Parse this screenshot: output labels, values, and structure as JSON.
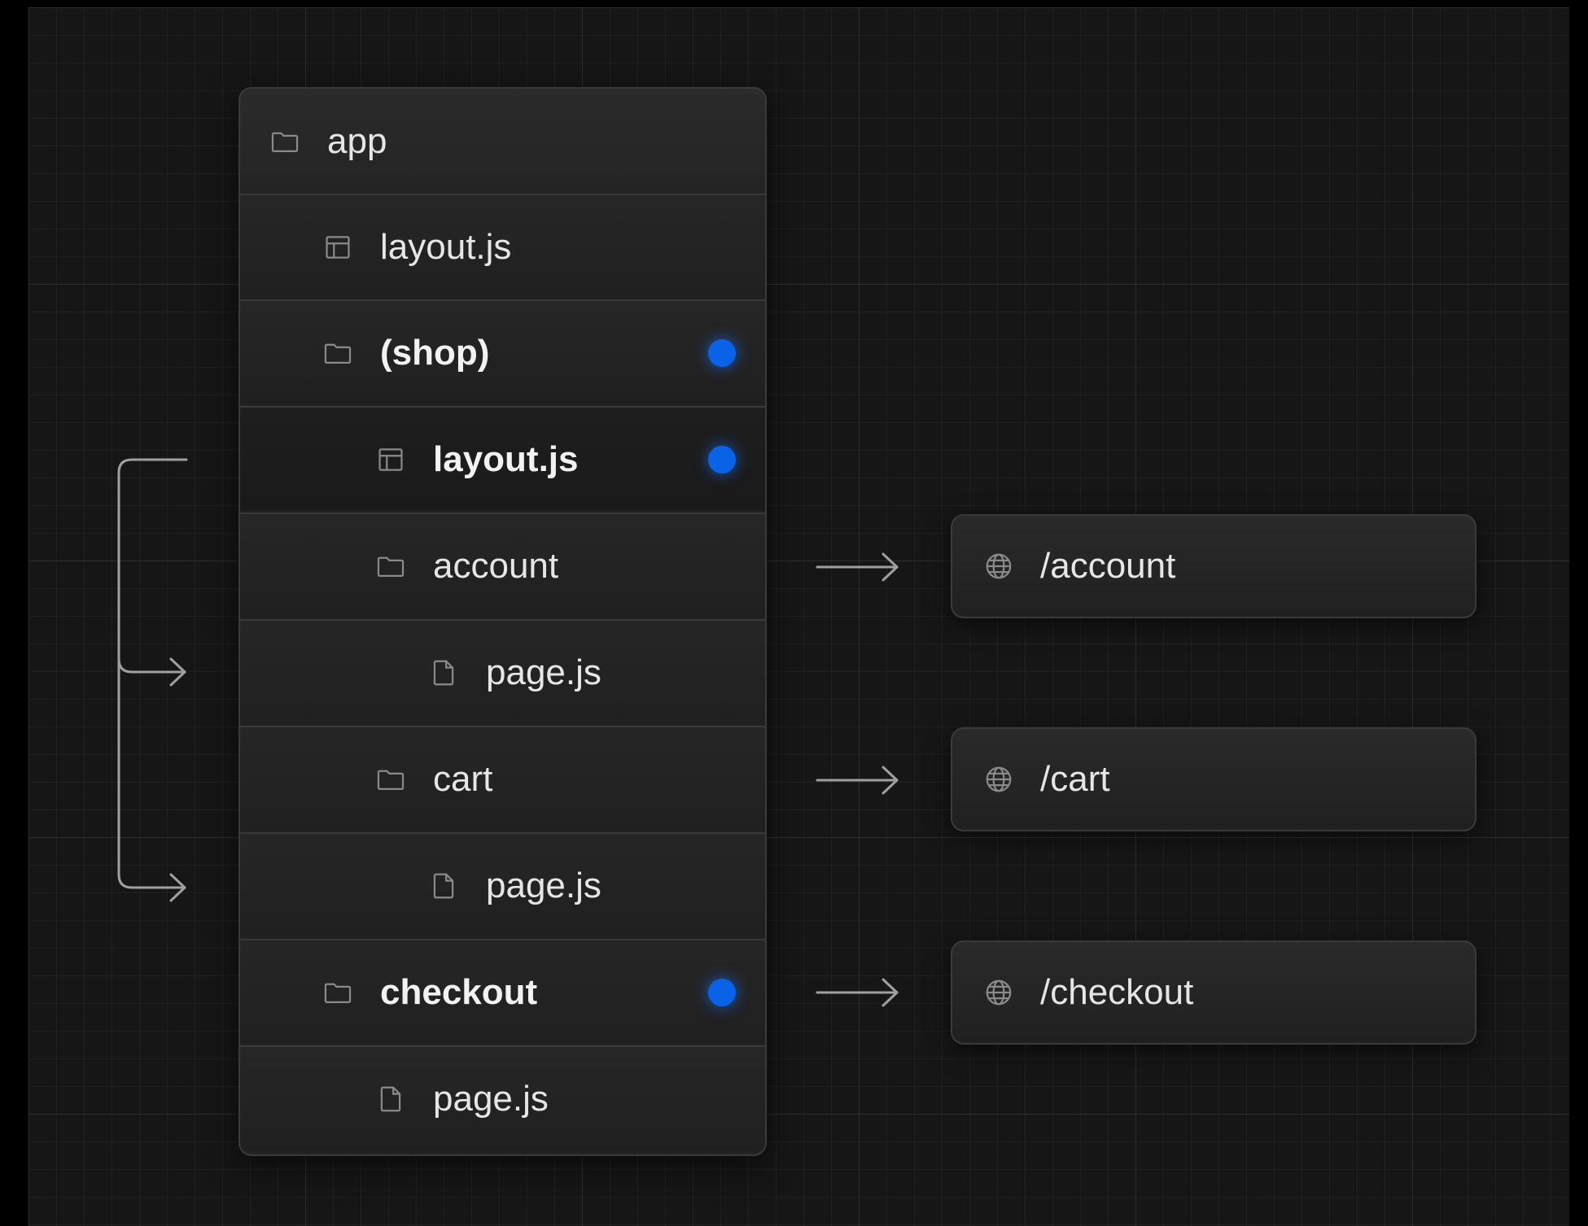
{
  "tree": {
    "rows": [
      {
        "label": "app",
        "icon": "folder-icon",
        "indent": 0,
        "bold": false,
        "dot": false
      },
      {
        "label": "layout.js",
        "icon": "layout-icon",
        "indent": 1,
        "bold": false,
        "dot": false
      },
      {
        "label": "(shop)",
        "icon": "folder-icon",
        "indent": 1,
        "bold": true,
        "dot": true
      },
      {
        "label": "layout.js",
        "icon": "layout-icon",
        "indent": 2,
        "bold": true,
        "dot": true
      },
      {
        "label": "account",
        "icon": "folder-icon",
        "indent": 2,
        "bold": false,
        "dot": false
      },
      {
        "label": "page.js",
        "icon": "file-icon",
        "indent": 3,
        "bold": false,
        "dot": false
      },
      {
        "label": "cart",
        "icon": "folder-icon",
        "indent": 2,
        "bold": false,
        "dot": false
      },
      {
        "label": "page.js",
        "icon": "file-icon",
        "indent": 3,
        "bold": false,
        "dot": false
      },
      {
        "label": "checkout",
        "icon": "folder-icon",
        "indent": 1,
        "bold": true,
        "dot": true
      },
      {
        "label": "page.js",
        "icon": "file-icon",
        "indent": 2,
        "bold": false,
        "dot": false
      }
    ]
  },
  "routes": [
    {
      "label": "/account",
      "icon": "globe-icon",
      "from_row": 4
    },
    {
      "label": "/cart",
      "icon": "globe-icon",
      "from_row": 6
    },
    {
      "label": "/checkout",
      "icon": "globe-icon",
      "from_row": 8
    }
  ],
  "colors": {
    "background": "#161616",
    "panel": "#222222",
    "border": "#3a3a3a",
    "accent_dot": "#0a63e6",
    "text": "#e6e6e6",
    "connector": "#9a9a9a"
  }
}
